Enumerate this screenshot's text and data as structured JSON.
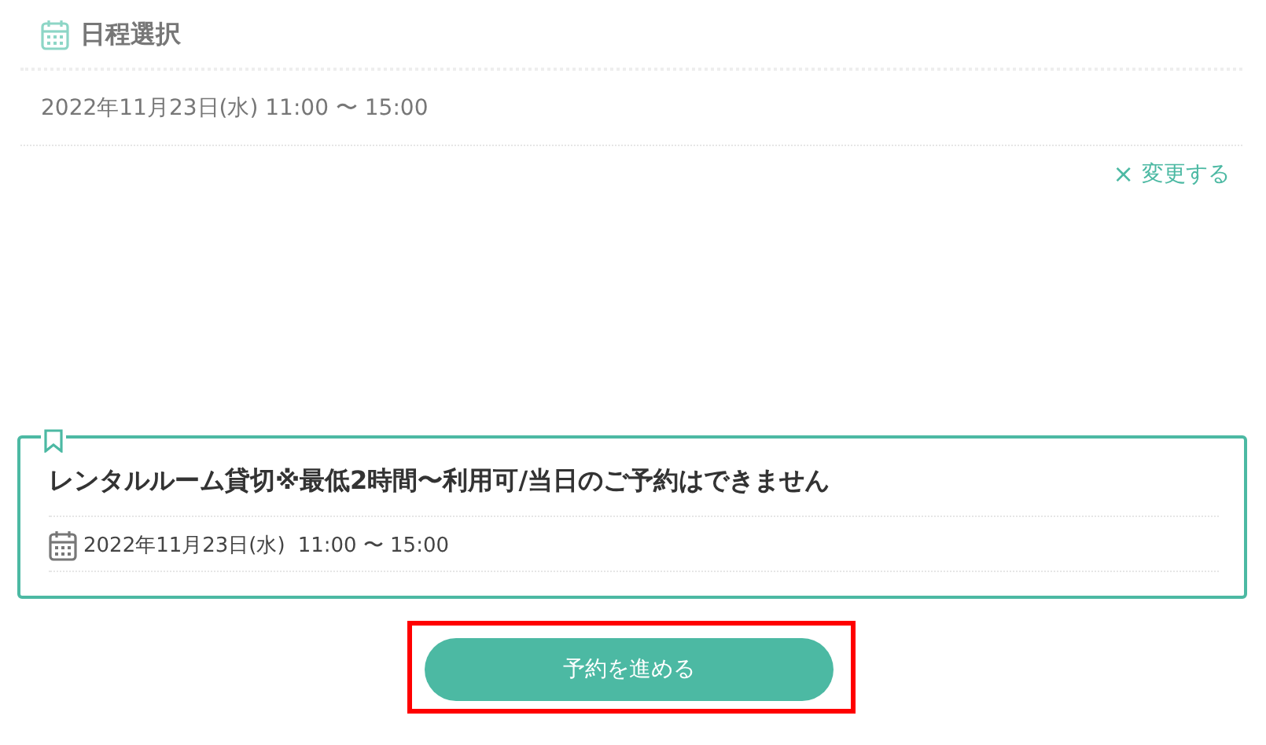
{
  "schedule": {
    "title": "日程選択",
    "datetime": "2022年11月23日(水) 11:00 〜 15:00",
    "change_link": {
      "icon": "×",
      "label": "変更する"
    }
  },
  "plan": {
    "title": "レンタルルーム貸切※最低2時間〜利用可/当日のご予約はできません",
    "date": "2022年11月23日(水)",
    "time": "11:00 〜 15:00"
  },
  "proceed_button": {
    "label": "予約を進める",
    "highlighted": true
  }
}
